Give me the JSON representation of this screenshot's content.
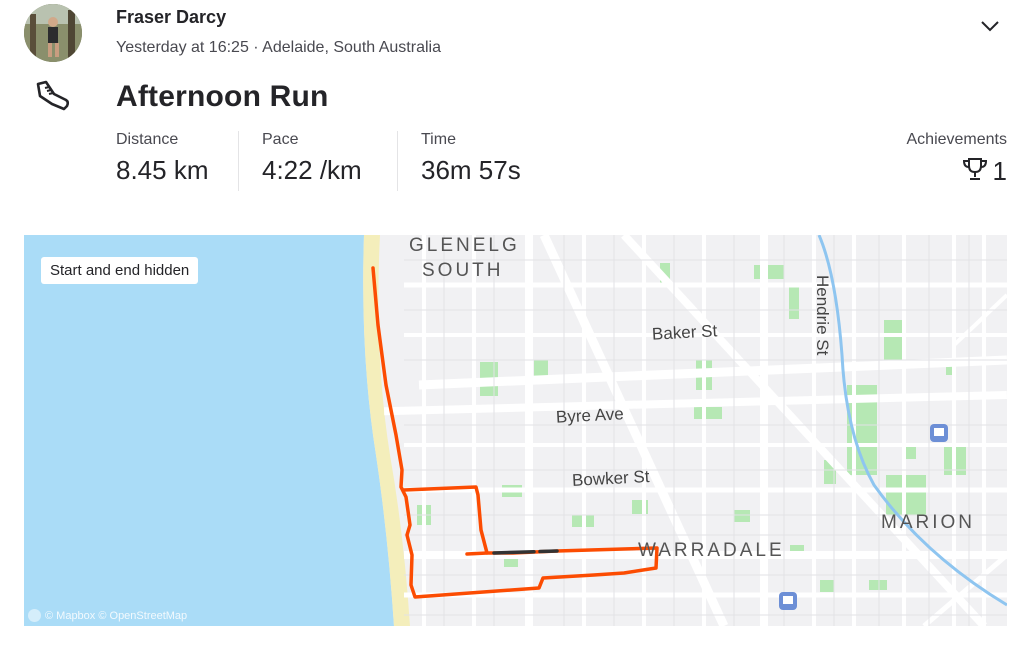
{
  "header": {
    "athlete_name": "Fraser Darcy",
    "meta": "Yesterday at 16:25 · Adelaide, South Australia"
  },
  "activity": {
    "title": "Afternoon Run",
    "sport_icon": "running-shoe-icon"
  },
  "stats": [
    {
      "label": "Distance",
      "value": "8.45 km"
    },
    {
      "label": "Pace",
      "value": "4:22 /km"
    },
    {
      "label": "Time",
      "value": "36m 57s"
    }
  ],
  "achievements": {
    "label": "Achievements",
    "count": "1",
    "icon": "trophy-icon"
  },
  "map": {
    "privacy_badge": "Start and end hidden",
    "attribution": "© Mapbox © OpenStreetMap",
    "labels": {
      "glenelg": "GLENELG",
      "south": "SOUTH",
      "baker": "Baker St",
      "byre": "Byre Ave",
      "bowker": "Bowker St",
      "hendrie": "Hendrie St",
      "marion": "MARION",
      "warradale": "WARRADALE"
    },
    "colors": {
      "water": "#aadcf7",
      "sand": "#f4eebb",
      "land": "#f1f1f3",
      "park": "#b6e8b4",
      "road": "#ffffff",
      "route": "#fc4c02",
      "hidden_route": "#333333",
      "creek": "#8ec5f0"
    }
  },
  "colors": {
    "text": "#242428",
    "muted": "#494950"
  }
}
